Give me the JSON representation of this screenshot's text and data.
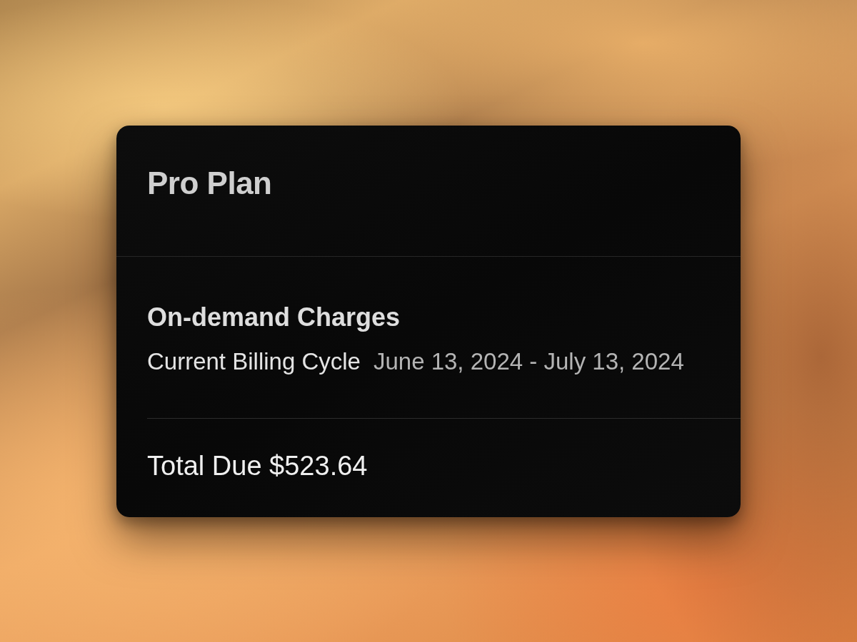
{
  "card": {
    "title": "Pro Plan",
    "section": {
      "heading": "On-demand Charges",
      "billing_cycle": {
        "label": "Current Billing Cycle",
        "dates": "June 13, 2024 - July 13, 2024"
      }
    },
    "total": {
      "text": "Total Due $523.64"
    }
  }
}
